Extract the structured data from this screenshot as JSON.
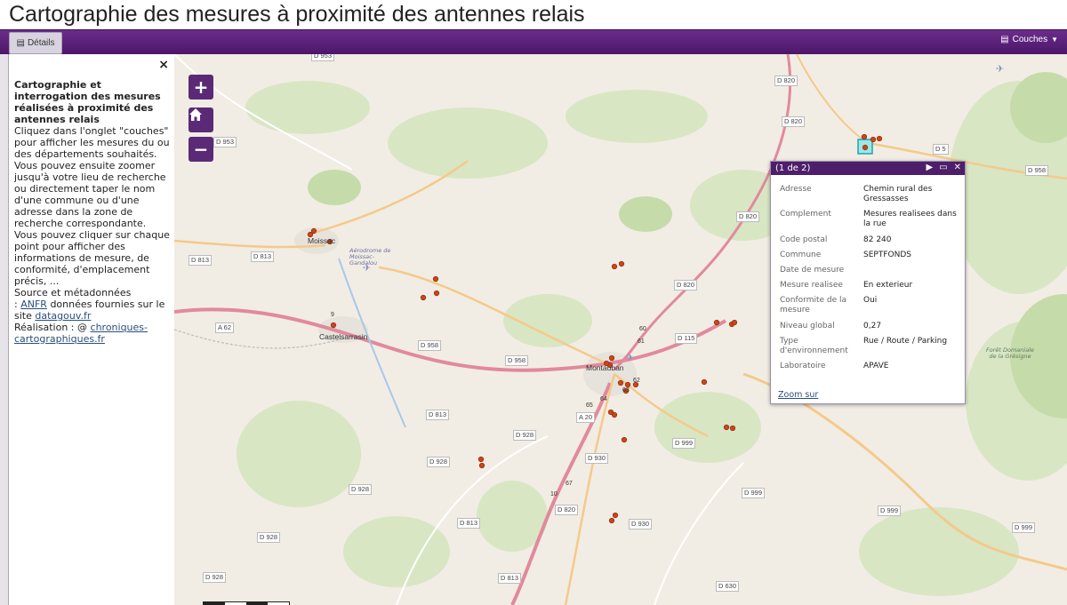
{
  "page": {
    "title": "Cartographie des mesures à proximité des antennes relais"
  },
  "toolbar": {
    "details_label": "Détails",
    "layers_label": "Couches"
  },
  "sidebar": {
    "close": "×",
    "heading": "Cartographie et interrogation des mesures réalisées à proximité des antennes relais",
    "p1": "Cliquez dans l'onglet \"couches\" pour afficher les mesures du ou des départements souhaités. Vous pouvez ensuite zoomer jusqu'à votre lieu de recherche ou directement taper le nom d'une commune ou d'une adresse dans la zone de recherche correspondante.",
    "p2": "Vous pouvez cliquer sur chaque point pour afficher des informations de mesure, de conformité, d'emplacement précis, ...",
    "source_label": "Source et métadonnées",
    "source_pre": ":",
    "anfr": "ANFR",
    "source_mid": "données fournies sur le site",
    "datagouv": "datagouv.fr",
    "realisation": "Réalisation : @",
    "chroniques": "chroniques-cartographiques.fr"
  },
  "map_controls": {
    "zoom_in": "+",
    "home_icon": "home-icon",
    "zoom_out": "−"
  },
  "popup": {
    "counter": "(1 de 2)",
    "rows": [
      {
        "k": "Adresse",
        "v": "Chemin rural des Gressasses"
      },
      {
        "k": "Complement",
        "v": "Mesures realisees dans la rue"
      },
      {
        "k": "Code postal",
        "v": "82 240"
      },
      {
        "k": "Commune",
        "v": "SEPTFONDS"
      },
      {
        "k": "Date de mesure",
        "v": ""
      },
      {
        "k": "Mesure realisee",
        "v": "En exterieur"
      },
      {
        "k": "Conformite de la mesure",
        "v": "Oui"
      },
      {
        "k": "Niveau global",
        "v": "0,27"
      },
      {
        "k": "Type d'environnement",
        "v": "Rue / Route / Parking"
      },
      {
        "k": "Laboratoire",
        "v": "APAVE"
      }
    ],
    "zoom_link": "Zoom sur"
  },
  "map_labels": {
    "towns": [
      "Moissac",
      "Castelsarrasin",
      "Montauban"
    ],
    "aerodrome": "Aérodrome de Moissac-Gandalou",
    "forest": "Forêt Domaniale de la Grésigne",
    "roads": [
      "D 953",
      "D 953",
      "D 820",
      "D 820",
      "D 5",
      "D 958",
      "D 820",
      "D 813",
      "D 813",
      "D 820",
      "A 62",
      "D 958",
      "D 115",
      "D 958",
      "D 813",
      "A 20",
      "D 928",
      "D 999",
      "D 928",
      "D 930",
      "D 928",
      "D 999",
      "D 999",
      "D 999",
      "D 928",
      "D 820",
      "D 813",
      "D 930",
      "D 928",
      "D 813",
      "D 630"
    ],
    "exits": [
      "9",
      "60",
      "61",
      "62",
      "63",
      "64",
      "65",
      "67",
      "10"
    ]
  },
  "colors": {
    "toolbar": "#5a2277",
    "marker": "#c8461a",
    "motorway": "#e2899c",
    "primary": "#f5c98a"
  }
}
